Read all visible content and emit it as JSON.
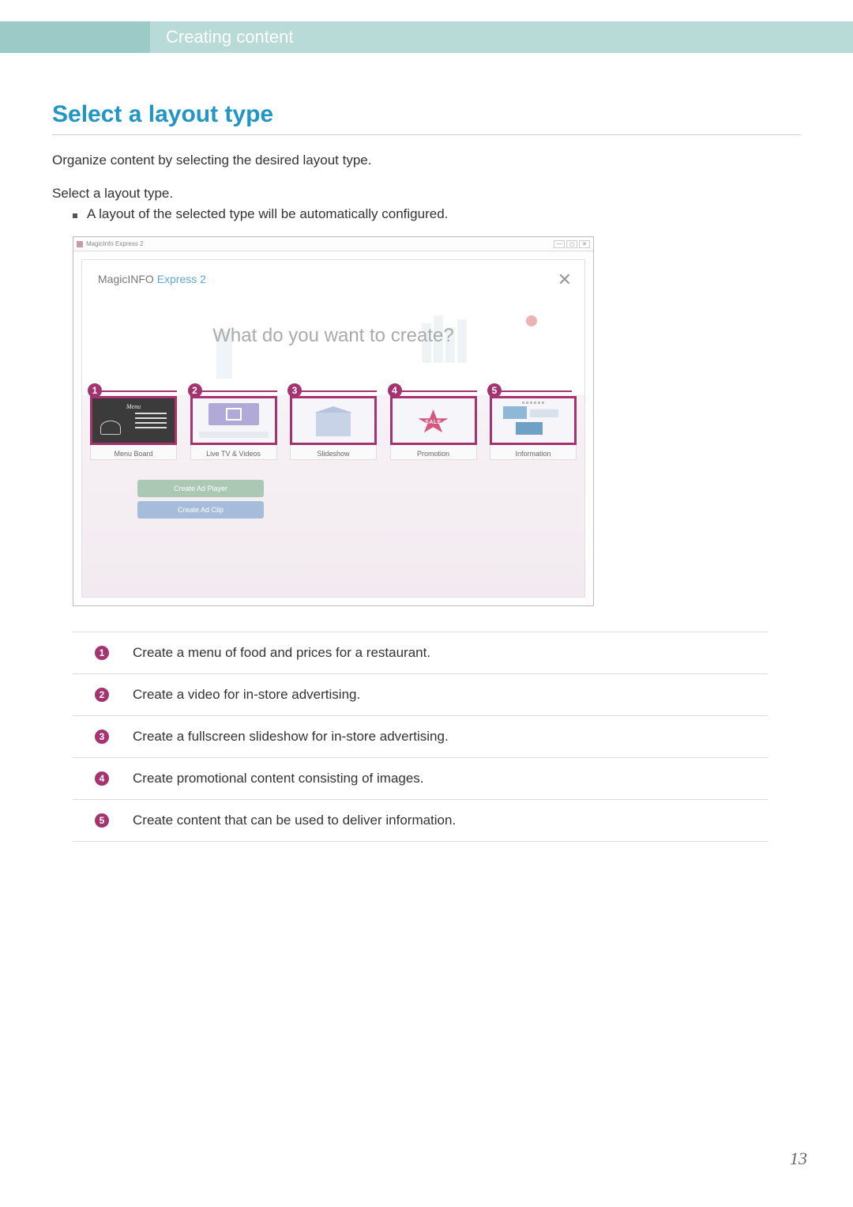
{
  "header": {
    "breadcrumb": "Creating content"
  },
  "section": {
    "title": "Select a layout type",
    "intro": "Organize content by selecting the desired layout type.",
    "step": "Select a layout type.",
    "bullet": "A layout of the selected type will be automatically configured."
  },
  "app": {
    "titlebar": "MagicInfo Express 2",
    "brand_prefix": "MagicINFO ",
    "brand_accent": "Express 2",
    "question": "What do you want to create?",
    "close": "✕",
    "ghost_btn1": "Create Ad Player",
    "ghost_btn2": "Create Ad Clip",
    "layouts": [
      {
        "num": "1",
        "label": "Menu Board"
      },
      {
        "num": "2",
        "label": "Live TV & Videos"
      },
      {
        "num": "3",
        "label": "Slideshow"
      },
      {
        "num": "4",
        "label": "Promotion",
        "badge": "SALE"
      },
      {
        "num": "5",
        "label": "Information"
      }
    ]
  },
  "descriptions": [
    {
      "num": "1",
      "text": "Create a menu of food and prices for a restaurant."
    },
    {
      "num": "2",
      "text": "Create a video for in-store advertising."
    },
    {
      "num": "3",
      "text": "Create a fullscreen slideshow for in-store advertising."
    },
    {
      "num": "4",
      "text": "Create promotional content consisting of images."
    },
    {
      "num": "5",
      "text": "Create content that can be used to deliver information."
    }
  ],
  "page_number": "13",
  "win_ctrls": {
    "min": "—",
    "max": "◻",
    "close": "✕"
  }
}
